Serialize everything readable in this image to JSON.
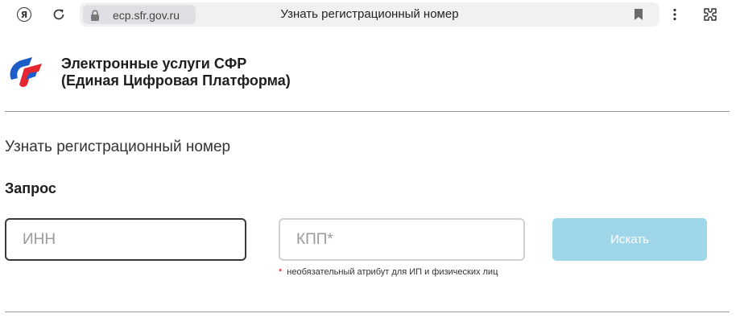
{
  "browser": {
    "domain": "ecp.sfr.gov.ru",
    "title": "Узнать регистрационный номер",
    "ya_glyph": "Я"
  },
  "header": {
    "brand_line1": "Электронные услуги СФР",
    "brand_line2": "(Единая Цифровая Платформа)"
  },
  "main": {
    "heading": "Узнать регистрационный номер",
    "section_title": "Запрос",
    "inn_placeholder": "ИНН",
    "kpp_placeholder": "КПП*",
    "search_label": "Искать",
    "note_star": "*",
    "note_text": "необязательный атрибут для ИП и физических лиц"
  },
  "colors": {
    "logo_blue": "#1e5cc8",
    "logo_red": "#e3262f",
    "button_bg": "#9fd6ea",
    "active_border": "#3a3a3a"
  }
}
